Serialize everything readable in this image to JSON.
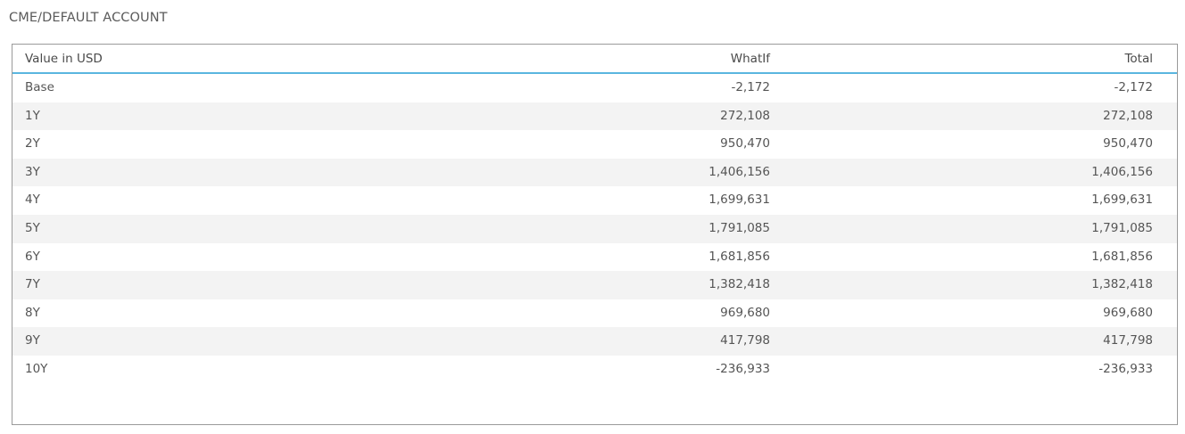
{
  "page_title": "CME/DEFAULT ACCOUNT",
  "table": {
    "headers": {
      "label": "Value in USD",
      "whatif": "WhatIf",
      "total": "Total"
    },
    "rows": [
      {
        "label": "Base",
        "whatif": "-2,172",
        "total": "-2,172"
      },
      {
        "label": "1Y",
        "whatif": "272,108",
        "total": "272,108"
      },
      {
        "label": "2Y",
        "whatif": "950,470",
        "total": "950,470"
      },
      {
        "label": "3Y",
        "whatif": "1,406,156",
        "total": "1,406,156"
      },
      {
        "label": "4Y",
        "whatif": "1,699,631",
        "total": "1,699,631"
      },
      {
        "label": "5Y",
        "whatif": "1,791,085",
        "total": "1,791,085"
      },
      {
        "label": "6Y",
        "whatif": "1,681,856",
        "total": "1,681,856"
      },
      {
        "label": "7Y",
        "whatif": "1,382,418",
        "total": "1,382,418"
      },
      {
        "label": "8Y",
        "whatif": "969,680",
        "total": "969,680"
      },
      {
        "label": "9Y",
        "whatif": "417,798",
        "total": "417,798"
      },
      {
        "label": "10Y",
        "whatif": "-236,933",
        "total": "-236,933"
      }
    ]
  },
  "colors": {
    "header_underline": "#5ab6df",
    "alt_row_background": "#f3f3f3",
    "panel_border": "#9a9a9a"
  }
}
